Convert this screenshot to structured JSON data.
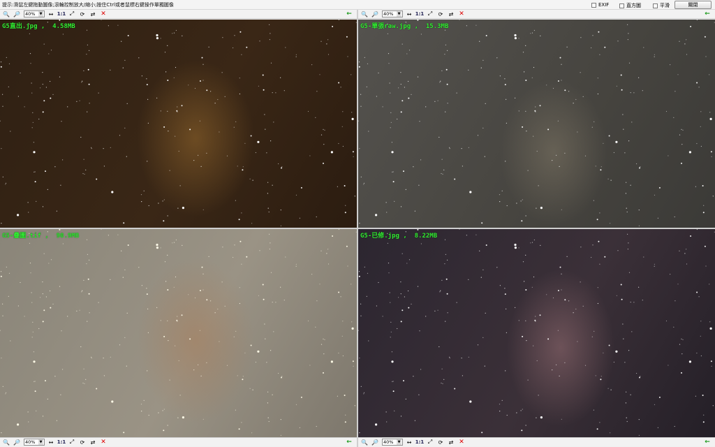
{
  "hint": "提示:滑鼠左鍵拖動圖像;滾輪控制放大/縮小;按住Ctrl或者鼠標右鍵操作單獨圖像",
  "options": [
    {
      "label": "EXIF",
      "checked": false
    },
    {
      "label": "直方圖",
      "checked": false
    },
    {
      "label": "平滑",
      "checked": false
    }
  ],
  "close_label": "關閉",
  "toolbar": {
    "zoom": "40%",
    "one_to_one": "1:1",
    "icons": [
      "zoom-in-icon",
      "zoom-out-icon",
      "zoom-select",
      "fit-width-icon",
      "actual-size",
      "fit-window-icon",
      "rotate-icon",
      "sync-icon",
      "close-icon",
      "back-icon"
    ]
  },
  "panels": [
    {
      "caption": "G5直出.jpg ,  4.58MB",
      "background": "#352415"
    },
    {
      "caption": "G5-單張raw.jpg ,  15.3MB",
      "background": "#4d4b47"
    },
    {
      "caption": "G5-疊圖.tif ,  90.9MB",
      "background": "#908a7d"
    },
    {
      "caption": "G5-已修.jpg ,  8.22MB",
      "background": "#30292f"
    }
  ],
  "colors": {
    "caption": "#33ee33",
    "close_x": "#dd0000",
    "back_arrow": "#1a9a1a"
  }
}
